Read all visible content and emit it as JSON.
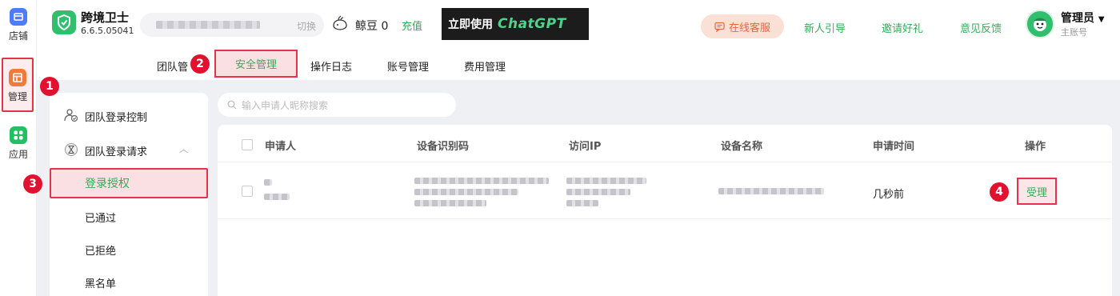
{
  "rail": {
    "items": [
      {
        "label": "店铺",
        "icon": "store-icon",
        "color": "#4c7df5"
      },
      {
        "label": "管理",
        "icon": "management-icon",
        "color": "#f07a3c"
      },
      {
        "label": "应用",
        "icon": "apps-icon",
        "color": "#22c063"
      }
    ]
  },
  "header": {
    "app_name": "跨境卫士",
    "version": "6.6.5.05041",
    "switch_label": "切换",
    "beans": "鲸豆 0",
    "recharge": "充值",
    "banner_text": "立即使用",
    "banner_brand": "ChatGPT",
    "service": "在线客服",
    "links": [
      "新人引导",
      "邀请好礼",
      "意见反馈"
    ],
    "admin_name": "管理员",
    "admin_sub": "主账号"
  },
  "tabs": {
    "team": "团队管",
    "security": "安全管理",
    "oplog": "操作日志",
    "account": "账号管理",
    "fees": "费用管理"
  },
  "side": {
    "login_control": "团队登录控制",
    "login_request": "团队登录请求",
    "authorize": "登录授权",
    "passed": "已通过",
    "rejected": "已拒绝",
    "blacklist": "黑名单"
  },
  "search": {
    "placeholder": "输入申请人昵称搜索"
  },
  "table": {
    "headers": [
      "申请人",
      "设备识别码",
      "访问IP",
      "设备名称",
      "申请时间",
      "操作"
    ],
    "rows": [
      {
        "time": "几秒前",
        "action": "受理"
      }
    ]
  },
  "markers": [
    "1",
    "2",
    "3",
    "4"
  ],
  "colors": {
    "accent_green": "#2fae5a",
    "highlight_red": "#e5344a",
    "marker_red": "#e0122f"
  }
}
